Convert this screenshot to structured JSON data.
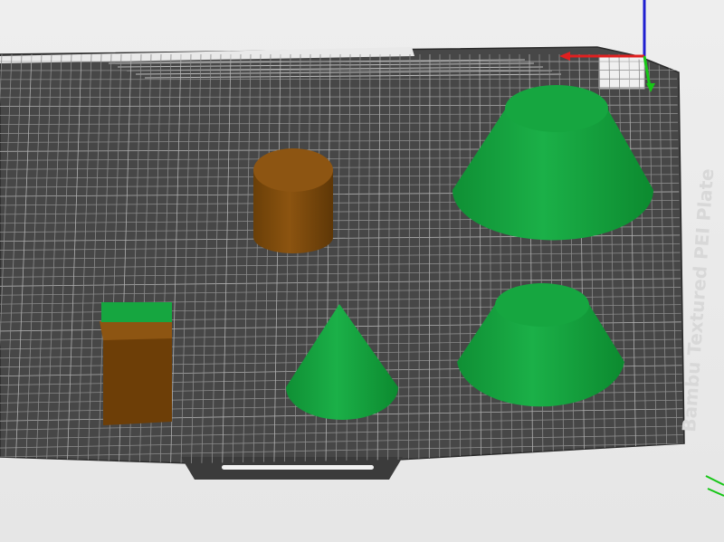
{
  "plate": {
    "label": "Bambu Textured PEI Plate"
  },
  "colors": {
    "plate": "#4a4a4a",
    "grid": "#8a8a8a",
    "green": "#15a43f",
    "brown": "#8b5511",
    "axis_x": "#e02020",
    "axis_y": "#16c616",
    "axis_z": "#1f1fd0"
  },
  "objects": [
    {
      "name": "cylinder",
      "color": "brown"
    },
    {
      "name": "truncated-cone-large",
      "color": "green"
    },
    {
      "name": "box-with-green-top",
      "color": "brown"
    },
    {
      "name": "cone",
      "color": "green"
    },
    {
      "name": "truncated-cone-small",
      "color": "green"
    }
  ]
}
